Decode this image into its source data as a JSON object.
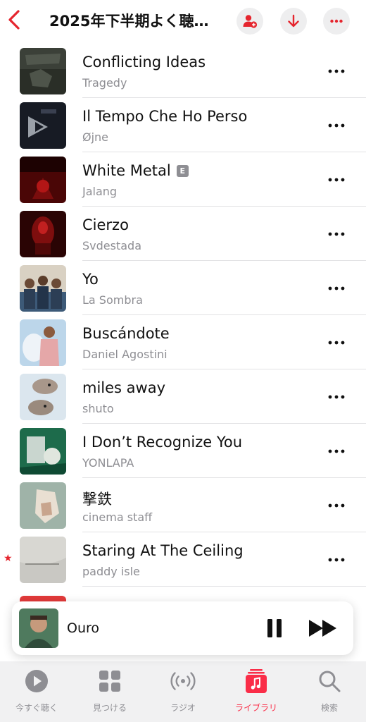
{
  "header": {
    "title": "2025年下半期よく聴…"
  },
  "songs": [
    {
      "title": "Conflicting Ideas",
      "artist": "Tragedy",
      "explicit": false
    },
    {
      "title": "Il Tempo Che Ho Perso",
      "artist": "Øjne",
      "explicit": false
    },
    {
      "title": "White Metal",
      "artist": "Jalang",
      "explicit": true,
      "explicit_label": "E"
    },
    {
      "title": "Cierzo",
      "artist": "Svdestada",
      "explicit": false
    },
    {
      "title": "Yo",
      "artist": "La Sombra",
      "explicit": false
    },
    {
      "title": "Buscándote",
      "artist": "Daniel Agostini",
      "explicit": false
    },
    {
      "title": "miles away",
      "artist": "shuto",
      "explicit": false
    },
    {
      "title": "I Don’t Recognize You",
      "artist": "YONLAPA",
      "explicit": false
    },
    {
      "title": "撃鉄",
      "artist": "cinema staff",
      "explicit": false
    },
    {
      "title": "Staring At The Ceiling",
      "artist": "paddy isle",
      "explicit": false,
      "starred": true,
      "star": "★"
    }
  ],
  "mini_player": {
    "title": "Ouro"
  },
  "tabs": [
    {
      "label": "今すぐ聴く",
      "icon": "play-circle-icon",
      "active": false
    },
    {
      "label": "見つける",
      "icon": "grid-icon",
      "active": false
    },
    {
      "label": "ラジオ",
      "icon": "radio-waves-icon",
      "active": false
    },
    {
      "label": "ライブラリ",
      "icon": "music-library-icon",
      "active": true
    },
    {
      "label": "検索",
      "icon": "magnifier-icon",
      "active": false
    }
  ],
  "colors": {
    "accent": "#fa2d48",
    "header_red": "#e5252e",
    "secondary_text": "#8e8e93"
  }
}
